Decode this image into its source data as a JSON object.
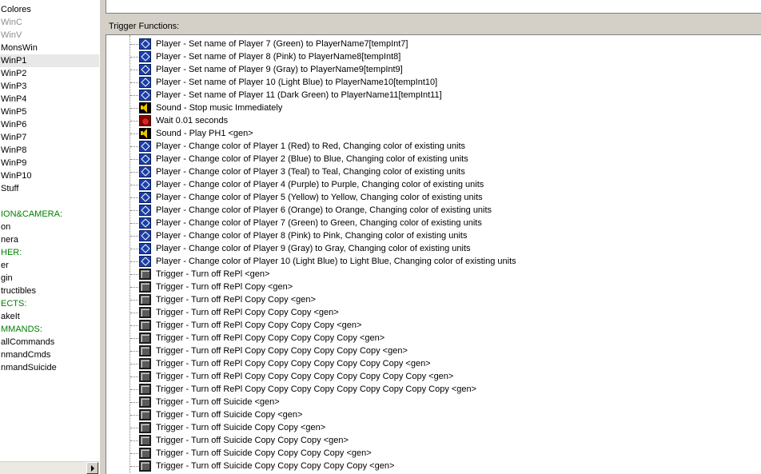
{
  "sidebar": {
    "items": [
      {
        "label": "Colores",
        "state": "normal"
      },
      {
        "label": "WinC",
        "state": "disabled"
      },
      {
        "label": "WinV",
        "state": "disabled"
      },
      {
        "label": "MonsWin",
        "state": "normal"
      },
      {
        "label": "WinP1",
        "state": "selected"
      },
      {
        "label": "WinP2",
        "state": "normal"
      },
      {
        "label": "WinP3",
        "state": "normal"
      },
      {
        "label": "WinP4",
        "state": "normal"
      },
      {
        "label": "WinP5",
        "state": "normal"
      },
      {
        "label": "WinP6",
        "state": "normal"
      },
      {
        "label": "WinP7",
        "state": "normal"
      },
      {
        "label": "WinP8",
        "state": "normal"
      },
      {
        "label": "WinP9",
        "state": "normal"
      },
      {
        "label": "WinP10",
        "state": "normal"
      },
      {
        "label": "Stuff",
        "state": "normal"
      },
      {
        "label": "",
        "state": "normal"
      },
      {
        "label": "ION&CAMERA:",
        "state": "category"
      },
      {
        "label": "on",
        "state": "normal"
      },
      {
        "label": "nera",
        "state": "normal"
      },
      {
        "label": "HER:",
        "state": "category"
      },
      {
        "label": "er",
        "state": "normal"
      },
      {
        "label": "gin",
        "state": "normal"
      },
      {
        "label": "tructibles",
        "state": "normal"
      },
      {
        "label": "ECTS:",
        "state": "category"
      },
      {
        "label": "akeIt",
        "state": "normal"
      },
      {
        "label": "MMANDS:",
        "state": "category"
      },
      {
        "label": "allCommands",
        "state": "normal"
      },
      {
        "label": "nmandCmds",
        "state": "normal"
      },
      {
        "label": "nmandSuicide",
        "state": "normal"
      }
    ]
  },
  "main": {
    "section_label": "Trigger Functions:",
    "actions": [
      {
        "icon": "player",
        "text": "Player - Set name of Player 7 (Green) to PlayerName7[tempInt7]"
      },
      {
        "icon": "player",
        "text": "Player - Set name of Player 8 (Pink) to PlayerName8[tempInt8]"
      },
      {
        "icon": "player",
        "text": "Player - Set name of Player 9 (Gray) to PlayerName9[tempInt9]"
      },
      {
        "icon": "player",
        "text": "Player - Set name of Player 10 (Light Blue) to PlayerName10[tempInt10]"
      },
      {
        "icon": "player",
        "text": "Player - Set name of Player 11 (Dark Green) to PlayerName11[tempInt11]"
      },
      {
        "icon": "sound",
        "text": "Sound - Stop music Immediately"
      },
      {
        "icon": "wait",
        "text": "Wait 0.01 seconds"
      },
      {
        "icon": "sound",
        "text": "Sound - Play PH1 <gen>"
      },
      {
        "icon": "player",
        "text": "Player - Change color of Player 1 (Red) to Red, Changing color of existing units"
      },
      {
        "icon": "player",
        "text": "Player - Change color of Player 2 (Blue) to Blue, Changing color of existing units"
      },
      {
        "icon": "player",
        "text": "Player - Change color of Player 3 (Teal) to Teal, Changing color of existing units"
      },
      {
        "icon": "player",
        "text": "Player - Change color of Player 4 (Purple) to Purple, Changing color of existing units"
      },
      {
        "icon": "player",
        "text": "Player - Change color of Player 5 (Yellow) to Yellow, Changing color of existing units"
      },
      {
        "icon": "player",
        "text": "Player - Change color of Player 6 (Orange) to Orange, Changing color of existing units"
      },
      {
        "icon": "player",
        "text": "Player - Change color of Player 7 (Green) to Green, Changing color of existing units"
      },
      {
        "icon": "player",
        "text": "Player - Change color of Player 8 (Pink) to Pink, Changing color of existing units"
      },
      {
        "icon": "player",
        "text": "Player - Change color of Player 9 (Gray) to Gray, Changing color of existing units"
      },
      {
        "icon": "player",
        "text": "Player - Change color of Player 10 (Light Blue) to Light Blue, Changing color of existing units"
      },
      {
        "icon": "trigger",
        "text": "Trigger - Turn off RePl <gen>"
      },
      {
        "icon": "trigger",
        "text": "Trigger - Turn off RePl Copy <gen>"
      },
      {
        "icon": "trigger",
        "text": "Trigger - Turn off RePl Copy Copy <gen>"
      },
      {
        "icon": "trigger",
        "text": "Trigger - Turn off RePl Copy Copy Copy <gen>"
      },
      {
        "icon": "trigger",
        "text": "Trigger - Turn off RePl Copy Copy Copy Copy <gen>"
      },
      {
        "icon": "trigger",
        "text": "Trigger - Turn off RePl Copy Copy Copy Copy Copy <gen>"
      },
      {
        "icon": "trigger",
        "text": "Trigger - Turn off RePl Copy Copy Copy Copy Copy Copy <gen>"
      },
      {
        "icon": "trigger",
        "text": "Trigger - Turn off RePl Copy Copy Copy Copy Copy Copy Copy <gen>"
      },
      {
        "icon": "trigger",
        "text": "Trigger - Turn off RePl Copy Copy Copy Copy Copy Copy Copy Copy <gen>"
      },
      {
        "icon": "trigger",
        "text": "Trigger - Turn off RePl Copy Copy Copy Copy Copy Copy Copy Copy Copy <gen>"
      },
      {
        "icon": "trigger",
        "text": "Trigger - Turn off Suicide <gen>"
      },
      {
        "icon": "trigger",
        "text": "Trigger - Turn off Suicide Copy <gen>"
      },
      {
        "icon": "trigger",
        "text": "Trigger - Turn off Suicide Copy Copy <gen>"
      },
      {
        "icon": "trigger",
        "text": "Trigger - Turn off Suicide Copy Copy Copy <gen>"
      },
      {
        "icon": "trigger",
        "text": "Trigger - Turn off Suicide Copy Copy Copy Copy <gen>"
      },
      {
        "icon": "trigger",
        "text": "Trigger - Turn off Suicide Copy Copy Copy Copy Copy <gen>"
      }
    ]
  },
  "icons": {
    "player": "player-action-icon",
    "sound": "sound-action-icon",
    "wait": "wait-action-icon",
    "trigger": "trigger-action-icon",
    "scroll_right": "scroll-right-arrow-icon"
  },
  "colors": {
    "category_text": "#008000",
    "disabled_text": "#8f8f8f",
    "window_bg": "#d4d0c8"
  }
}
